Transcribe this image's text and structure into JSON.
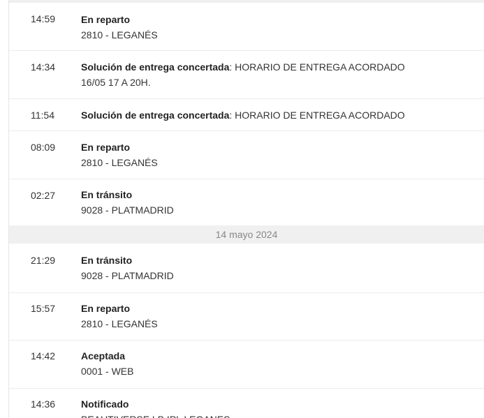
{
  "events_group_1": [
    {
      "time": "14:59",
      "status": "En reparto",
      "location": "2810 - LEGANÉS"
    },
    {
      "time": "14:34",
      "status": "Solución de entrega concertada",
      "detail": ": HORARIO DE ENTREGA ACORDADO",
      "location": "16/05 17 A 20H."
    },
    {
      "time": "11:54",
      "status": "Solución de entrega concertada",
      "detail": ": HORARIO DE ENTREGA ACORDADO"
    },
    {
      "time": "08:09",
      "status": "En reparto",
      "location": "2810 - LEGANÉS"
    },
    {
      "time": "02:27",
      "status": "En tránsito",
      "location": "9028 - PLATMADRID"
    }
  ],
  "date_separator": "14 mayo 2024",
  "events_group_2": [
    {
      "time": "21:29",
      "status": "En tránsito",
      "location": "9028 - PLATMADRID"
    },
    {
      "time": "15:57",
      "status": "En reparto",
      "location": "2810 - LEGANÉS"
    },
    {
      "time": "14:42",
      "status": "Aceptada",
      "location": "0001 - WEB"
    },
    {
      "time": "14:36",
      "status": "Notificado",
      "location": "BEAUTIVERSE LB IPL LEGANES"
    }
  ]
}
